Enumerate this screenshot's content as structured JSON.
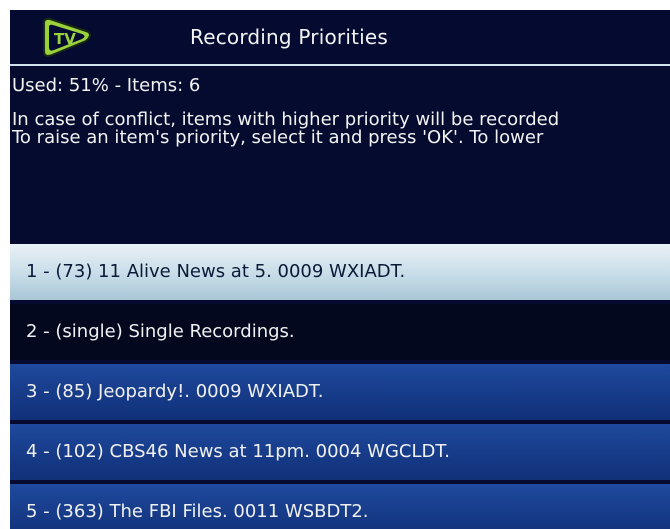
{
  "header": {
    "logo_icon": "tv-logo-icon",
    "title": "Recording Priorities"
  },
  "info": {
    "used_line": "Used: 51% - Items: 6",
    "description_line1": "In case of conflict, items with higher priority will be recorded",
    "description_line2": "To raise an item's priority, select it and press 'OK'. To lower"
  },
  "list": {
    "items": [
      {
        "label": "1 - (73) 11 Alive News at 5. 0009 WXIADT.",
        "state": "selected"
      },
      {
        "label": "2 - (single) Single Recordings.",
        "state": "normal"
      },
      {
        "label": "3 - (85) Jeopardy!. 0009 WXIADT.",
        "state": "normal"
      },
      {
        "label": "4 - (102) CBS46 News at 11pm. 0004 WGCLDT.",
        "state": "normal"
      },
      {
        "label": "5 - (363) The FBI Files. 0011 WSBDT2.",
        "state": "normal"
      }
    ]
  },
  "colors": {
    "background": "#040b2e",
    "header_rule": "#cfe2ee",
    "selected_row": "#c7dce8",
    "blue_row": "#173c8a",
    "logo_green": "#9ad23b"
  }
}
